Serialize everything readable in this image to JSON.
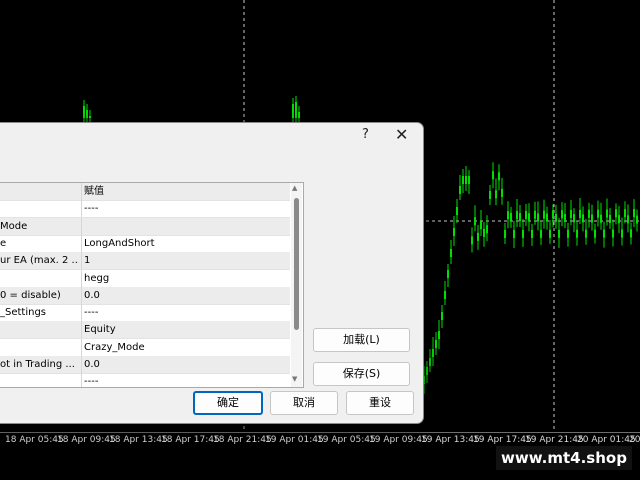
{
  "chart": {
    "colors": {
      "background": "#000000",
      "candle": "#00e000",
      "grid": "#d0d0d0",
      "crosshair": "#c8c8c8"
    },
    "time_labels": [
      "18 Apr 05:45",
      "18 Apr 09:45",
      "18 Apr 13:45",
      "18 Apr 17:45",
      "18 Apr 21:45",
      "19 Apr 01:45",
      "19 Apr 05:45",
      "19 Apr 09:45",
      "19 Apr 13:45",
      "19 Apr 17:45",
      "19 Apr 21:45",
      "20 Apr 01:45",
      "20 Apr"
    ]
  },
  "dialog": {
    "help_icon": "?",
    "close_icon": "✕",
    "column_header": "赋值",
    "rows": [
      {
        "name": "",
        "value": "赋值"
      },
      {
        "name": "",
        "value": "----"
      },
      {
        "name": "Mode",
        "value": ""
      },
      {
        "name": "e",
        "value": "LongAndShort"
      },
      {
        "name": "ur EA (max. 2 ...",
        "value": "1"
      },
      {
        "name": "",
        "value": "hegg"
      },
      {
        "name": "0 = disable)",
        "value": "0.0"
      },
      {
        "name": "_Settings",
        "value": "----"
      },
      {
        "name": "",
        "value": "Equity"
      },
      {
        "name": "",
        "value": "Crazy_Mode"
      },
      {
        "name": "ot in Trading ...",
        "value": "0.0"
      },
      {
        "name": "",
        "value": "----"
      }
    ],
    "buttons": {
      "load": "加载(L)",
      "save": "保存(S)",
      "ok": "确定",
      "cancel": "取消",
      "reset": "重设"
    }
  },
  "watermark": "www.mt4.shop"
}
